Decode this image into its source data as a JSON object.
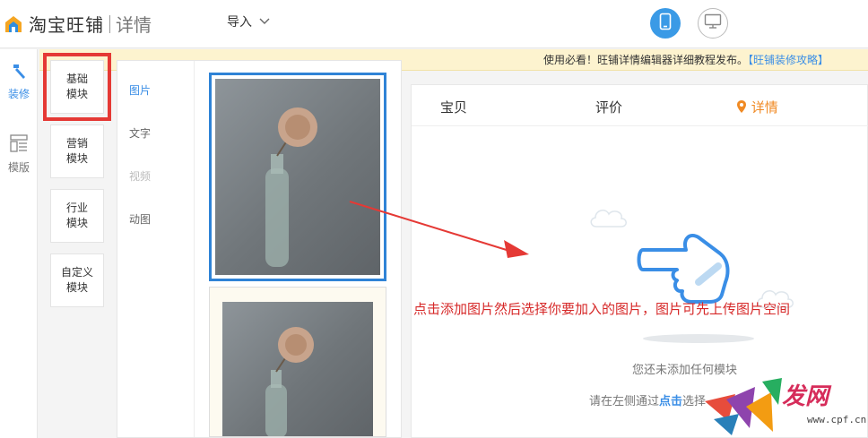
{
  "header": {
    "logo_text": "淘宝旺铺",
    "logo_sub": "详情",
    "import_label": "导入"
  },
  "rail": {
    "items": [
      {
        "label": "装修",
        "active": true
      },
      {
        "label": "模版",
        "active": false
      }
    ]
  },
  "notice": {
    "text": "使用必看！旺铺详情编辑器详细教程发布。",
    "link": "【旺铺装修攻略】"
  },
  "modules": [
    {
      "line1": "基础",
      "line2": "模块"
    },
    {
      "line1": "营销",
      "line2": "模块"
    },
    {
      "line1": "行业",
      "line2": "模块"
    },
    {
      "line1": "自定义",
      "line2": "模块"
    }
  ],
  "asset_tabs": [
    "图片",
    "文字",
    "视频",
    "动图"
  ],
  "preview": {
    "tabs": [
      "宝贝",
      "评价",
      "详情"
    ],
    "empty_text": "您还未添加任何模块",
    "hint_prefix": "请在左侧通过",
    "hint_emph": "点击",
    "hint_suffix": "选择"
  },
  "annotation": "点击添加图片然后选择你要加入的图片，图片可先上传图片空间",
  "watermark": {
    "url": "www.cpf.cn"
  },
  "colors": {
    "accent": "#3a8ee6",
    "active_tab": "#f08a24",
    "annotation": "#d62828",
    "notice_bg": "#fdf3cf"
  }
}
